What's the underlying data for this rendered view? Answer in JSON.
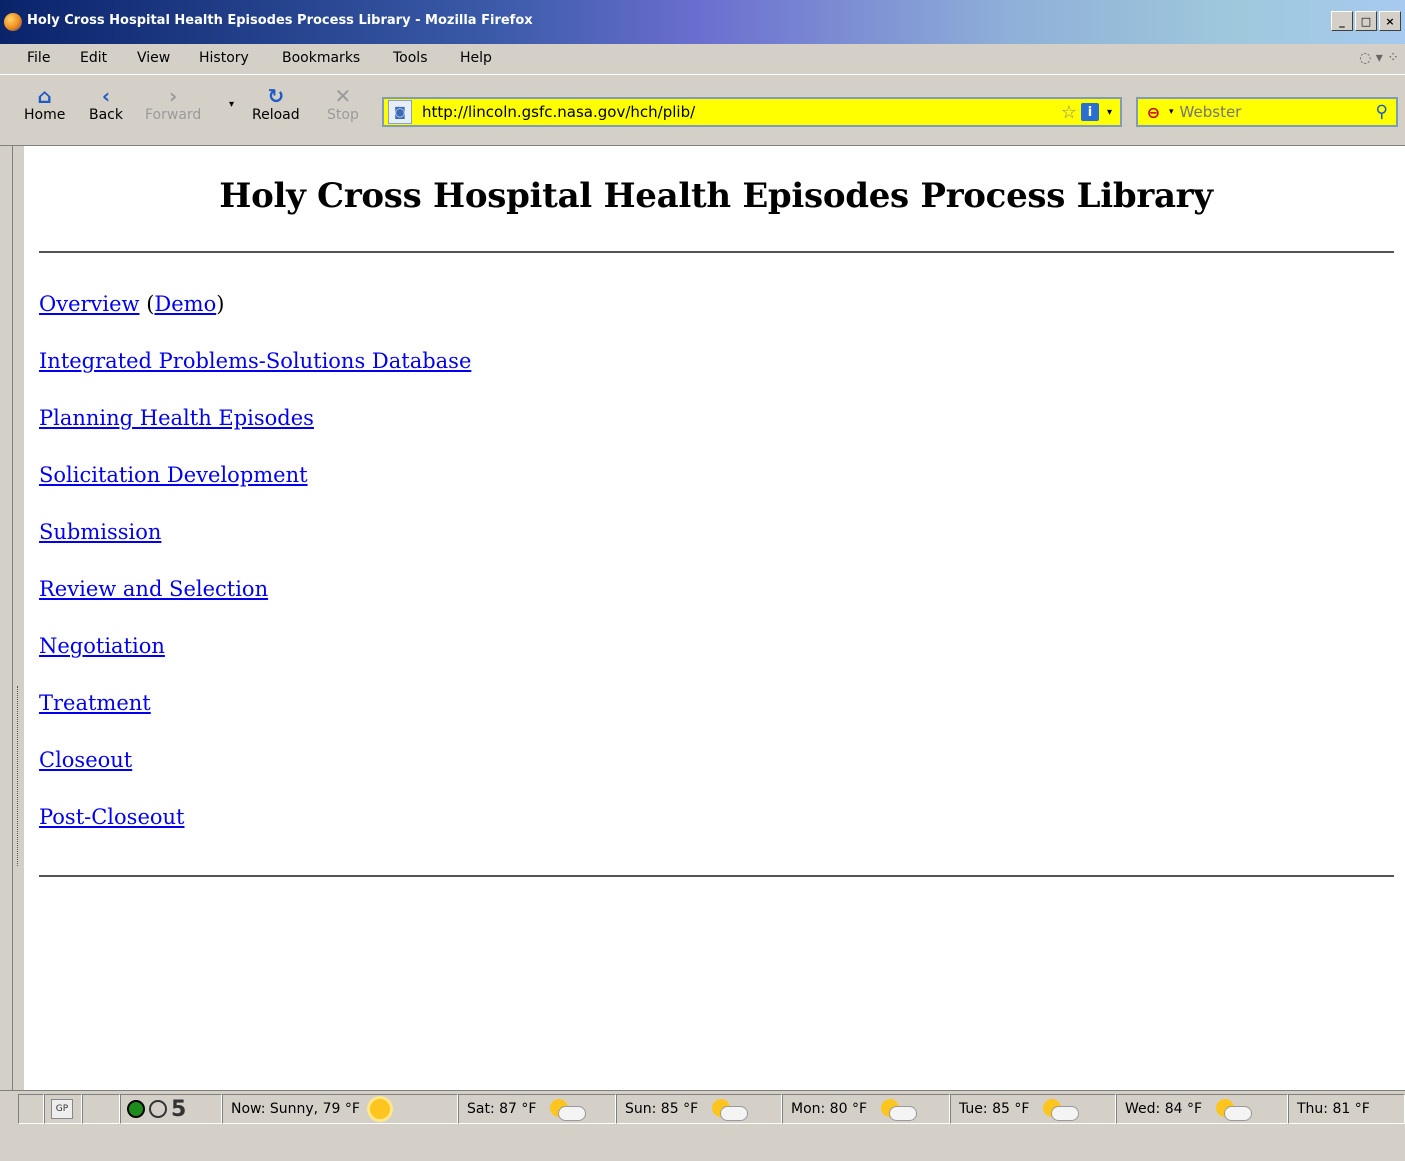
{
  "window": {
    "title": "Holy Cross Hospital Health Episodes Process Library - Mozilla Firefox",
    "controls": {
      "minimize": "_",
      "maximize": "□",
      "close": "×"
    }
  },
  "menu": [
    "File",
    "Edit",
    "View",
    "History",
    "Bookmarks",
    "Tools",
    "Help"
  ],
  "toolbar": {
    "home": "Home",
    "back": "Back",
    "forward": "Forward",
    "reload": "Reload",
    "stop": "Stop"
  },
  "address": {
    "url": "http://lincoln.gsfc.nasa.gov/hch/plib/"
  },
  "search": {
    "placeholder": "Webster"
  },
  "page": {
    "heading": "Holy Cross Hospital Health Episodes Process Library",
    "overview": "Overview",
    "demo_open": "(",
    "demo": "Demo",
    "demo_close": ")",
    "links": [
      "Integrated Problems-Solutions Database",
      "Planning Health Episodes",
      "Solicitation Development",
      "Submission",
      "Review and Selection",
      "Negotiation",
      "Treatment",
      "Closeout",
      "Post-Closeout"
    ]
  },
  "status": {
    "gp": "GP",
    "count": "5",
    "weather": [
      {
        "label": "Now: Sunny, 79 °F",
        "icon": "sun-icon"
      },
      {
        "label": "Sat: 87 °F",
        "icon": "partly-cloudy-icon"
      },
      {
        "label": "Sun: 85 °F",
        "icon": "partly-cloudy-icon"
      },
      {
        "label": "Mon: 80 °F",
        "icon": "partly-cloudy-icon"
      },
      {
        "label": "Tue: 85 °F",
        "icon": "partly-cloudy-icon"
      },
      {
        "label": "Wed: 84 °F",
        "icon": "partly-cloudy-icon"
      },
      {
        "label": "Thu: 81 °F",
        "icon": "partly-cloudy-icon"
      }
    ]
  }
}
